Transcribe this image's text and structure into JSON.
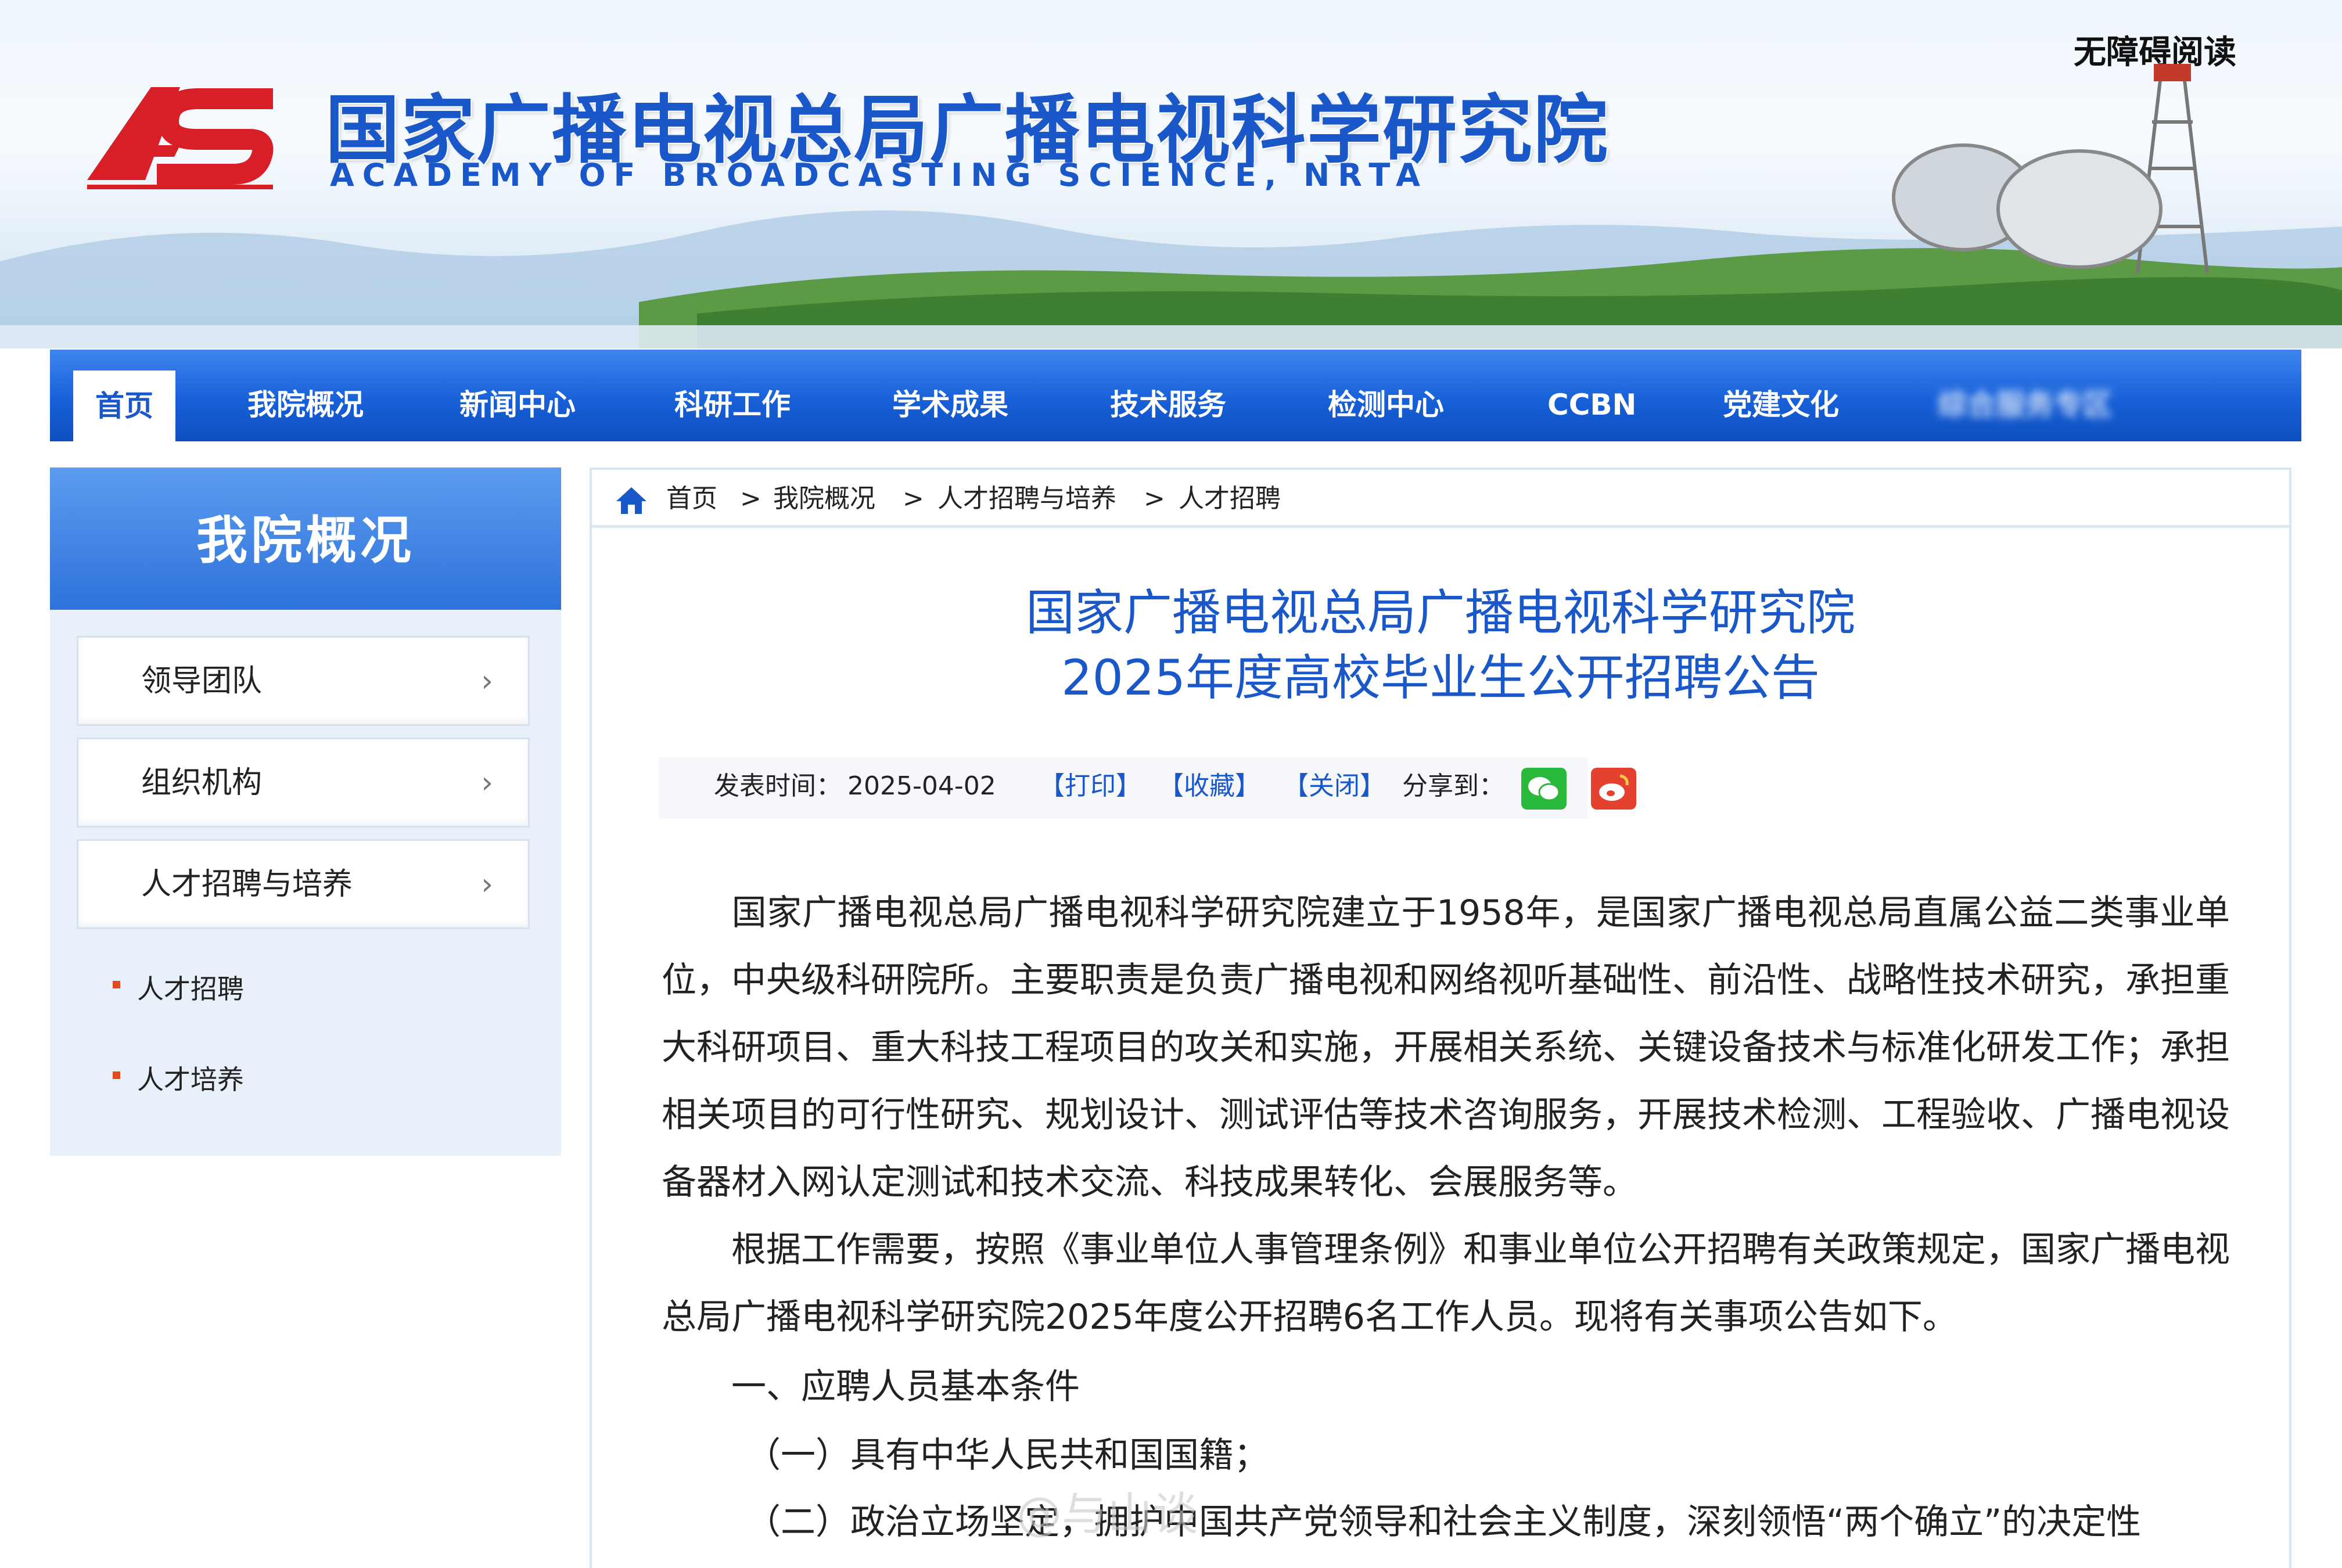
{
  "header": {
    "site_title": "国家广播电视总局广播电视科学研究院",
    "site_subtitle": "ACADEMY OF BROADCASTING SCIENCE, NRTA",
    "accessibility": "无障碍阅读",
    "logo_icon": "abs-logo-icon"
  },
  "nav": {
    "items": [
      "首页",
      "我院概况",
      "新闻中心",
      "科研工作",
      "学术成果",
      "技术服务",
      "检测中心",
      "CCBN",
      "党建文化",
      "综合服务专区"
    ],
    "active": "首页"
  },
  "sidebar": {
    "title": "我院概况",
    "items": [
      "领导团队",
      "组织机构",
      "人才招聘与培养"
    ],
    "sub_items": [
      "人才招聘",
      "人才培养"
    ]
  },
  "breadcrumb": {
    "items": [
      "首页",
      "我院概况",
      "人才招聘与培养",
      "人才招聘"
    ],
    "separator": ">"
  },
  "article": {
    "title_line1": "国家广播电视总局广播电视科学研究院",
    "title_line2": "2025年度高校毕业生公开招聘公告",
    "publish_label": "发表时间：",
    "publish_date": "2025-04-02",
    "print": "【打印】",
    "favorite": "【收藏】",
    "close": "【关闭】",
    "share_label": "分享到：",
    "para1": "国家广播电视总局广播电视科学研究院建立于1958年，是国家广播电视总局直属公益二类事业单位，中央级科研院所。主要职责是负责广播电视和网络视听基础性、前沿性、战略性技术研究，承担重大科研项目、重大科技工程项目的攻关和实施，开展相关系统、关键设备技术与标准化研发工作；承担相关项目的可行性研究、规划设计、测试评估等技术咨询服务，开展技术检测、工程验收、广播电视设备器材入网认定测试和技术交流、科技成果转化、会展服务等。",
    "para2": "根据工作需要，按照《事业单位人事管理条例》和事业单位公开招聘有关政策规定，国家广播电视总局广播电视科学研究院2025年度公开招聘6名工作人员。现将有关事项公告如下。",
    "section1": "一、应聘人员基本条件",
    "item1": "（一）具有中华人民共和国国籍；",
    "item2": "（二）政治立场坚定，拥护中国共产党领导和社会主义制度，深刻领悟“两个确立”的决定性"
  },
  "watermark": "@与山谈",
  "colors": {
    "brand_blue": "#1a57c8",
    "nav_blue": "#1760d8",
    "wechat_green": "#28b83a",
    "weibo_red": "#e4412f",
    "bullet_red": "#e34a1c"
  }
}
